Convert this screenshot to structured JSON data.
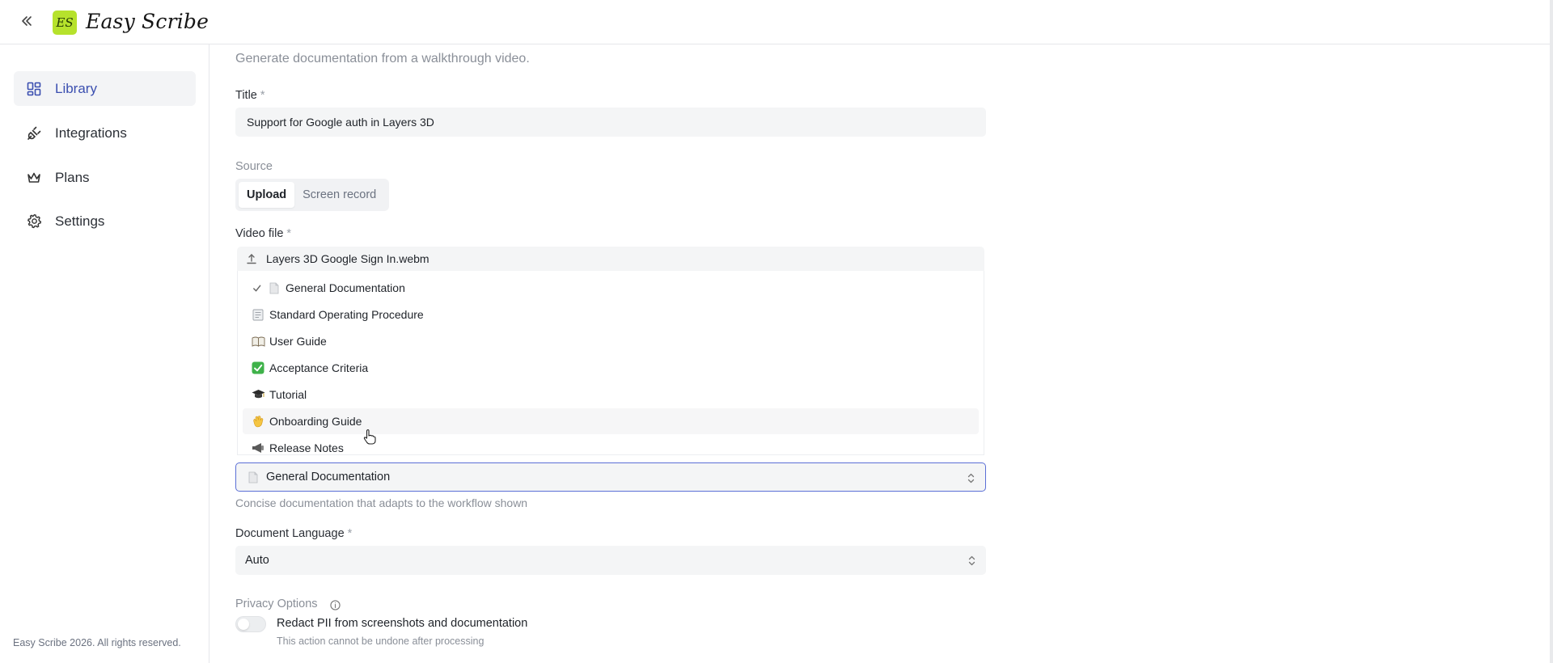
{
  "app": {
    "title": "Easy Scribe",
    "logo_initials": "ES",
    "logo_color": "#b6e22c",
    "accent_color": "#3b4fb0"
  },
  "sidebar": {
    "items": [
      {
        "label": "Library",
        "icon": "grid-icon",
        "active": true
      },
      {
        "label": "Integrations",
        "icon": "plug-icon",
        "active": false
      },
      {
        "label": "Plans",
        "icon": "crown-icon",
        "active": false
      },
      {
        "label": "Settings",
        "icon": "gear-icon",
        "active": false
      }
    ],
    "footer": "Easy Scribe 2026. All rights reserved."
  },
  "form": {
    "subtitle": "Generate documentation from a walkthrough video.",
    "title_label": "Title",
    "required_mark": "*",
    "title_value": "Support for Google auth in Layers 3D",
    "source_label": "Source",
    "source_options": [
      "Upload",
      "Screen record"
    ],
    "source_selected": "Upload",
    "video_label": "Video file",
    "video_file": "Layers 3D Google Sign In.webm",
    "doc_type_options": [
      {
        "emoji": "📄",
        "label": "General Documentation",
        "checked": true
      },
      {
        "emoji": "📃",
        "label": "Standard Operating Procedure",
        "checked": false
      },
      {
        "emoji": "📖",
        "label": "User Guide",
        "checked": false
      },
      {
        "emoji": "✅",
        "label": "Acceptance Criteria",
        "checked": false
      },
      {
        "emoji": "🎓",
        "label": "Tutorial",
        "checked": false
      },
      {
        "emoji": "👋",
        "label": "Onboarding Guide",
        "checked": false,
        "hover": true
      },
      {
        "emoji": "📣",
        "label": "Release Notes",
        "checked": false
      }
    ],
    "doc_type_selected": {
      "emoji": "📄",
      "label": "General Documentation"
    },
    "doc_type_helper": "Concise documentation that adapts to the workflow shown",
    "language_label": "Document Language",
    "language_value": "Auto",
    "privacy_label": "Privacy Options",
    "privacy_toggle_label": "Redact PII from screenshots and documentation",
    "privacy_toggle_sub": "This action cannot be undone after processing",
    "privacy_toggle_on": false
  }
}
